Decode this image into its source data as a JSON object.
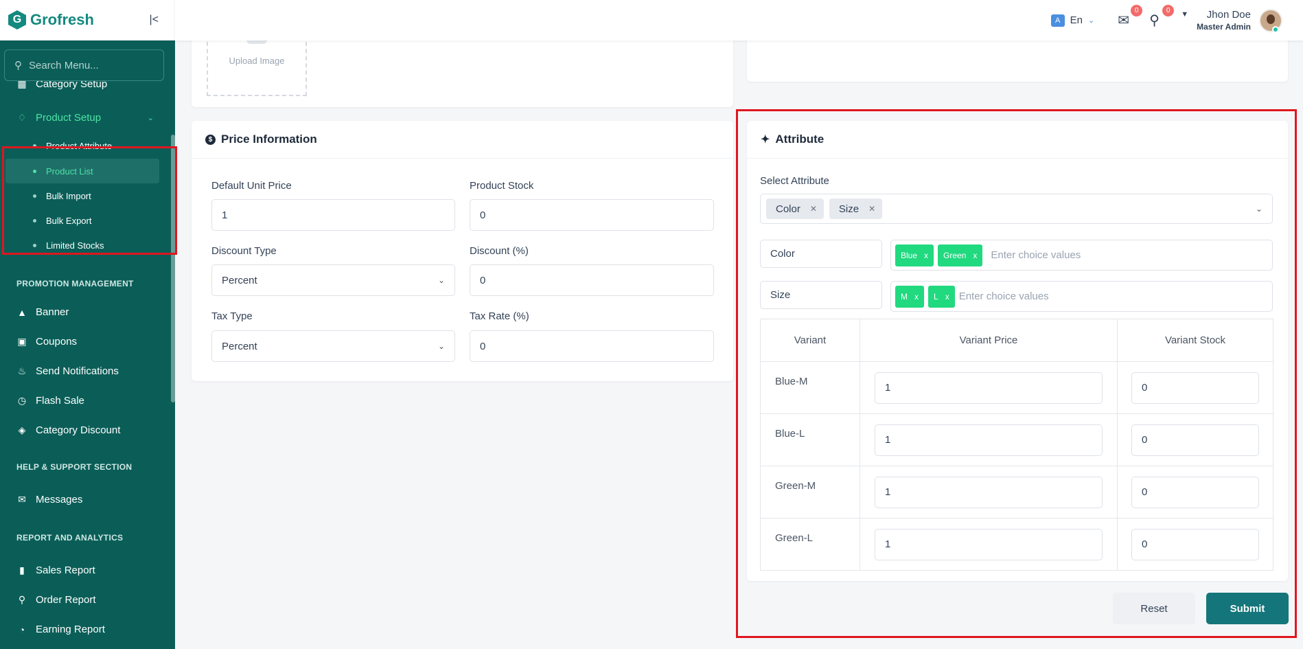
{
  "app": {
    "name": "Grofresh"
  },
  "search": {
    "placeholder": "Search Menu..."
  },
  "sidebar": {
    "category_setup": "Category Setup",
    "product_setup": "Product Setup",
    "product_setup_sub": [
      "Product Attribute",
      "Product List",
      "Bulk Import",
      "Bulk Export",
      "Limited Stocks"
    ],
    "sections": [
      {
        "title": "PROMOTION MANAGEMENT",
        "items": [
          "Banner",
          "Coupons",
          "Send Notifications",
          "Flash Sale",
          "Category Discount"
        ]
      },
      {
        "title": "HELP & SUPPORT SECTION",
        "items": [
          "Messages"
        ]
      },
      {
        "title": "REPORT AND ANALYTICS",
        "items": [
          "Sales Report",
          "Order Report",
          "Earning Report"
        ]
      }
    ]
  },
  "header": {
    "language": "En",
    "messages_count": "0",
    "cart_count": "0",
    "user_name": "Jhon Doe",
    "user_role": "Master Admin"
  },
  "upload": {
    "label": "Upload Image"
  },
  "price": {
    "title": "Price Information",
    "default_unit_price_label": "Default Unit Price",
    "default_unit_price": "1",
    "product_stock_label": "Product Stock",
    "product_stock": "0",
    "discount_type_label": "Discount Type",
    "discount_type": "Percent",
    "discount_label": "Discount (%)",
    "discount": "0",
    "tax_type_label": "Tax Type",
    "tax_type": "Percent",
    "tax_rate_label": "Tax Rate (%)",
    "tax_rate": "0"
  },
  "attribute": {
    "title": "Attribute",
    "select_label": "Select Attribute",
    "selected": [
      "Color",
      "Size"
    ],
    "rows": [
      {
        "name": "Color",
        "choices": [
          "Blue",
          "Green"
        ]
      },
      {
        "name": "Size",
        "choices": [
          "M",
          "L"
        ]
      }
    ],
    "choice_placeholder": "Enter choice values",
    "table_headers": [
      "Variant",
      "Variant Price",
      "Variant Stock"
    ],
    "variants": [
      {
        "name": "Blue-M",
        "price": "1",
        "stock": "0"
      },
      {
        "name": "Blue-L",
        "price": "1",
        "stock": "0"
      },
      {
        "name": "Green-M",
        "price": "1",
        "stock": "0"
      },
      {
        "name": "Green-L",
        "price": "1",
        "stock": "0"
      }
    ],
    "reset_label": "Reset",
    "submit_label": "Submit"
  },
  "colors": {
    "primary": "#0b5e58",
    "accent": "#4de3a5",
    "tag": "#21d97f",
    "submit": "#14767a",
    "highlight": "#e0161e"
  }
}
